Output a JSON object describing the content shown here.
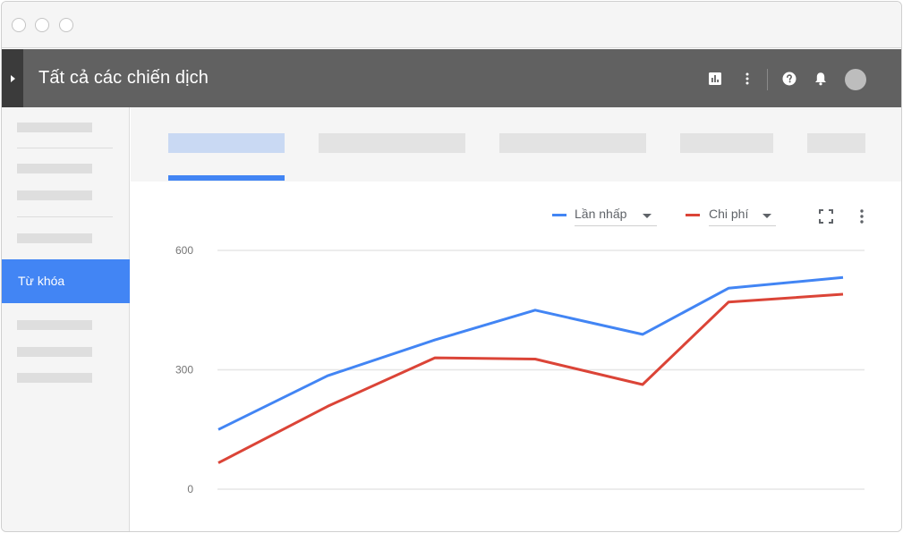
{
  "window": {
    "controls": [
      "close",
      "minimize",
      "maximize"
    ]
  },
  "appbar": {
    "title": "Tất cả các chiến dịch",
    "icons": [
      "report-icon",
      "more-vert-icon",
      "help-icon",
      "notifications-icon",
      "avatar"
    ]
  },
  "sidebar": {
    "active_item": "Từ khóa"
  },
  "tabs": {
    "count": 5,
    "active_index": 0
  },
  "chart_toolbar": {
    "metric1": "Lần nhấp",
    "metric2": "Chi phí",
    "icons": [
      "fullscreen-icon",
      "more-vert-icon"
    ]
  },
  "colors": {
    "series1": "#4285f4",
    "series2": "#db4437",
    "appbar": "#616161",
    "accent": "#4285f4"
  },
  "chart_data": {
    "type": "line",
    "x": [
      1,
      2,
      3,
      4,
      5,
      6,
      7
    ],
    "ylim": [
      0,
      600
    ],
    "yticks": [
      "600",
      "300",
      "0"
    ],
    "grid": true,
    "series": [
      {
        "name": "Lần nhấp",
        "color": "#4285f4",
        "values": [
          150,
          285,
          375,
          450,
          389,
          505,
          532
        ]
      },
      {
        "name": "Chi phí",
        "color": "#db4437",
        "values": [
          66,
          208,
          330,
          327,
          263,
          470,
          490
        ]
      }
    ]
  }
}
